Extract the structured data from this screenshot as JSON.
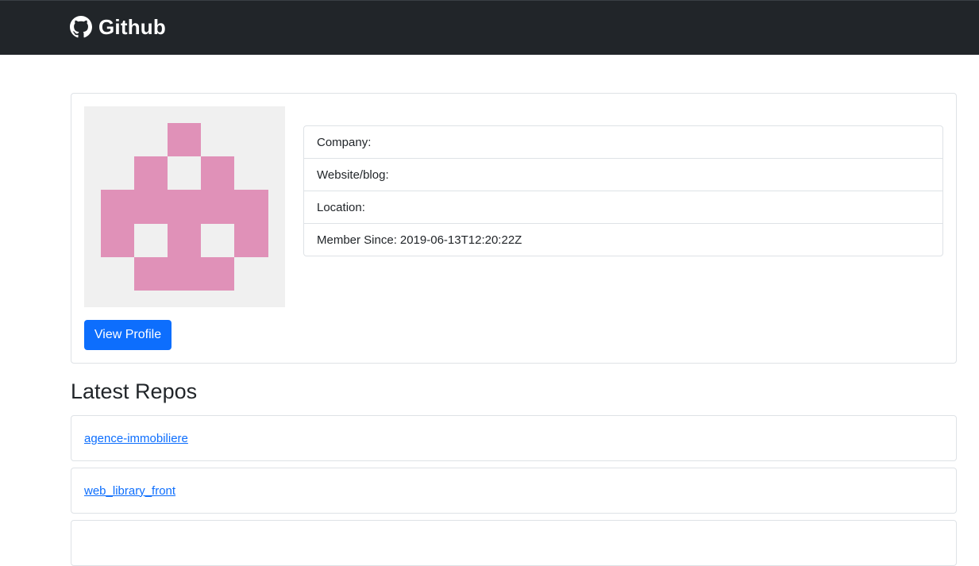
{
  "navbar": {
    "brand_label": "Github",
    "brand_icon": "github-icon"
  },
  "profile": {
    "avatar": {
      "background": "#f0f0f0",
      "fill": "#e091b8"
    },
    "view_profile_label": "View Profile",
    "info": [
      {
        "label": "Company:",
        "value": ""
      },
      {
        "label": "Website/blog:",
        "value": ""
      },
      {
        "label": "Location:",
        "value": ""
      },
      {
        "label": "Member Since:",
        "value": "2019-06-13T12:20:22Z"
      }
    ]
  },
  "repos": {
    "title": "Latest Repos",
    "items": [
      {
        "name": "agence-immobiliere"
      },
      {
        "name": "web_library_front"
      },
      {
        "name": ""
      }
    ]
  },
  "colors": {
    "navbar_bg": "#212529",
    "primary": "#0d6efd",
    "border": "#dee2e6"
  }
}
